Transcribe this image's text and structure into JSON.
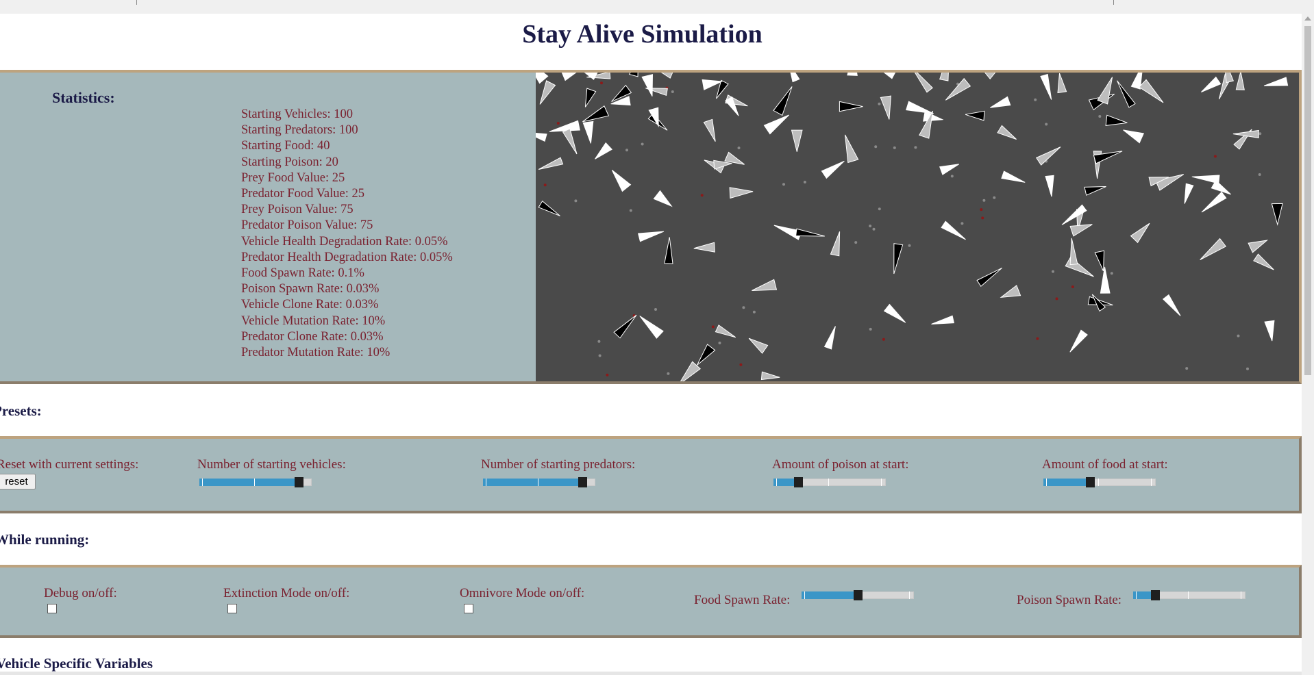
{
  "page": {
    "title": "Stay Alive Simulation"
  },
  "statistics": {
    "heading": "Statistics:",
    "lines": [
      "Starting Vehicles: 100",
      "Starting Predators: 100",
      "Starting Food: 40",
      "Starting Poison: 20",
      "Prey Food Value: 25",
      "Predator Food Value: 25",
      "Prey Poison Value: 75",
      "Predator Poison Value: 75",
      "Vehicle Health Degradation Rate: 0.05%",
      "Predator Health Degradation Rate: 0.05%",
      "Food Spawn Rate: 0.1%",
      "Poison Spawn Rate: 0.03%",
      "Vehicle Clone Rate: 0.03%",
      "Vehicle Mutation Rate: 10%",
      "Predator Clone Rate: 0.03%",
      "Predator Mutation Rate: 10%"
    ]
  },
  "simulation": {
    "background": "#4a4a4a",
    "prey_color": "#ffffff",
    "predator_color": "#000000",
    "food_color": "#8a8a8a",
    "poison_color": "#8b1a1a"
  },
  "presets": {
    "heading": "Presets:",
    "reset_label": "Reset with current settings:",
    "reset_button": "reset",
    "sliders": [
      {
        "label": "Number of starting vehicles:",
        "value": 0.92
      },
      {
        "label": "Number of starting predators:",
        "value": 0.92
      },
      {
        "label": "Amount of poison at start:",
        "value": 0.2
      },
      {
        "label": "Amount of food at start:",
        "value": 0.41
      }
    ]
  },
  "running": {
    "heading": "While running:",
    "toggles": [
      {
        "label": "Debug on/off:",
        "checked": false
      },
      {
        "label": "Extinction Mode on/off:",
        "checked": false
      },
      {
        "label": "Omnivore Mode on/off:",
        "checked": false
      }
    ],
    "sliders": [
      {
        "label": "Food Spawn Rate:",
        "value": 0.5
      },
      {
        "label": "Poison Spawn Rate:",
        "value": 0.17
      }
    ]
  },
  "vehicle_section": {
    "heading": "Vehicle Specific Variables"
  },
  "colors": {
    "panel": "#a5b8bb",
    "border": "#8b7d6b",
    "heading": "#1b1b47",
    "text": "#7a2230",
    "slider_fill": "#3b96c7"
  }
}
